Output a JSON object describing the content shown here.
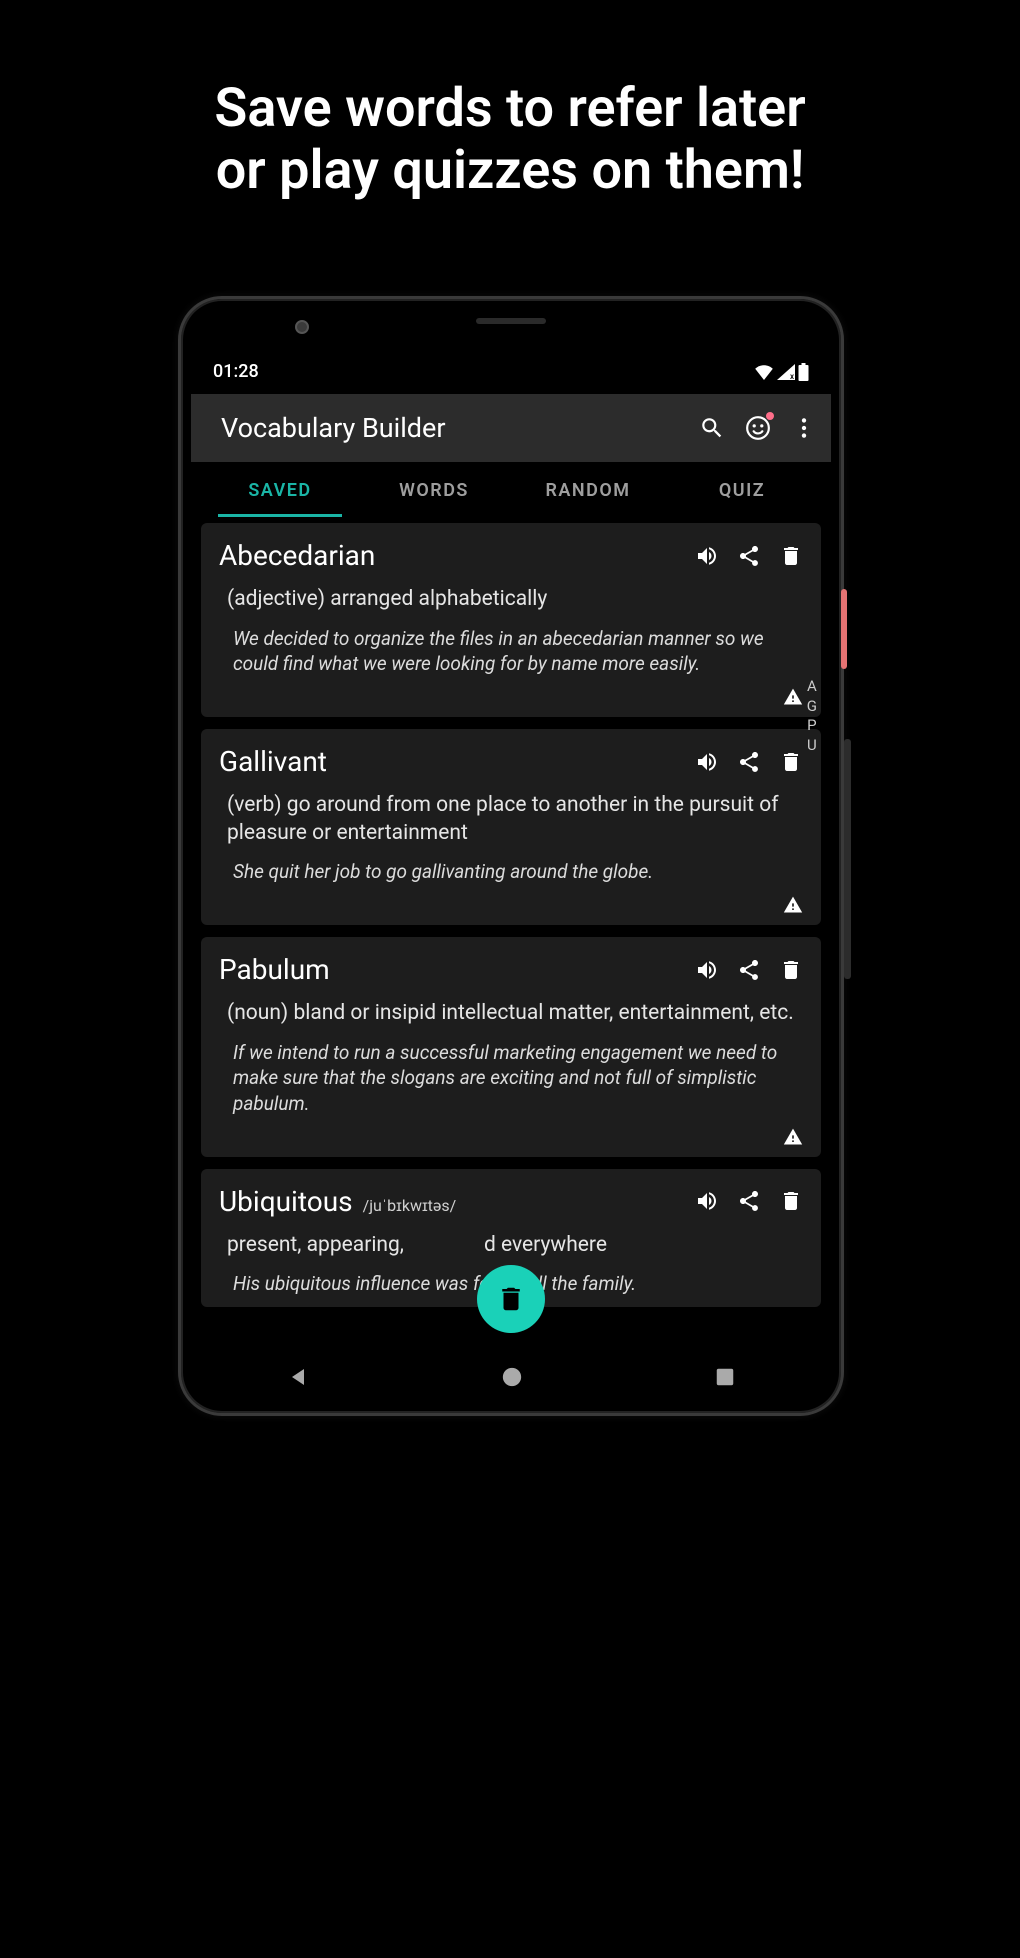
{
  "promo_line1": "Save words to refer later",
  "promo_line2": "or play quizzes on them!",
  "status_time": "01:28",
  "app_title": "Vocabulary Builder",
  "tabs": {
    "saved": "SAVED",
    "words": "WORDS",
    "random": "RANDOM",
    "quiz": "QUIZ"
  },
  "alpha_index": [
    "A",
    "G",
    "P",
    "U"
  ],
  "words": [
    {
      "title": "Abecedarian",
      "definition": "(adjective) arranged alphabetically",
      "example": "We decided to organize the files in an abecedarian manner so we could find what we were looking for by name more easily."
    },
    {
      "title": "Gallivant",
      "definition": "(verb) go around from one place to another in the pursuit of pleasure or entertainment",
      "example": "She quit her job to go gallivanting around the globe."
    },
    {
      "title": "Pabulum",
      "definition": "(noun) bland or insipid intellectual matter, entertainment, etc.",
      "example": "If we intend to run a successful marketing engagement we need to make sure that the slogans are exciting and not full of simplistic pabulum."
    },
    {
      "title": "Ubiquitous",
      "phonetic": "/juˈbɪkwɪtəs/",
      "definition_pre": "present, appearing,",
      "definition_post": "d everywhere",
      "example": "His ubiquitous influence was felt by all the family."
    }
  ]
}
